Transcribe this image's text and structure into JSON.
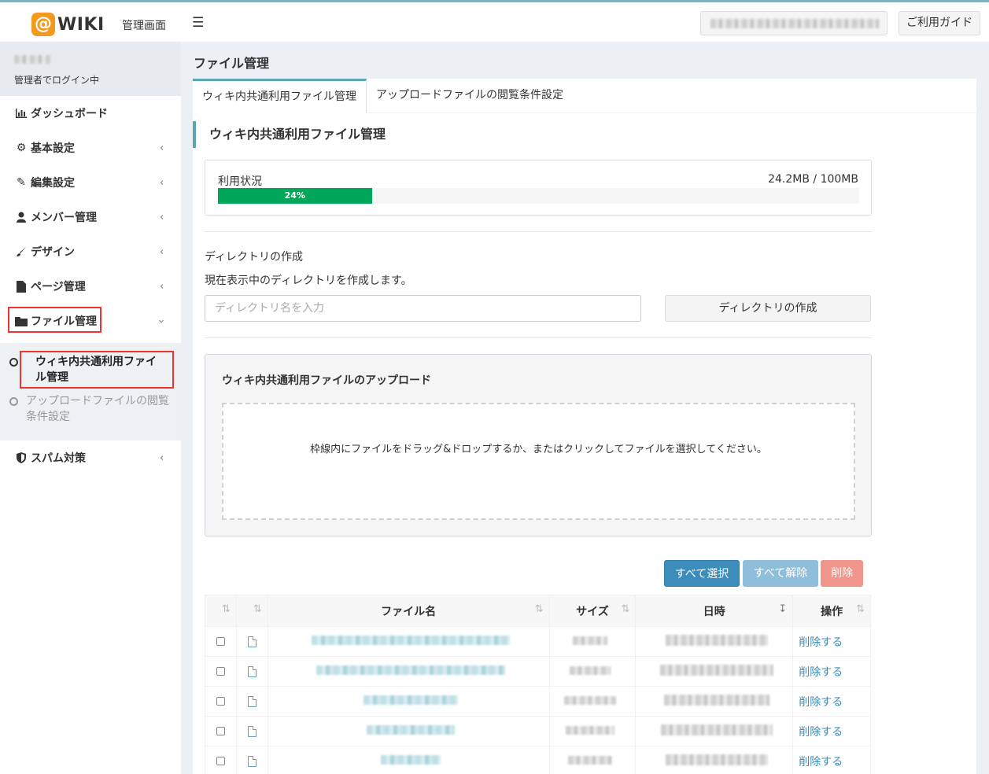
{
  "header": {
    "logo_mark": "@",
    "logo_text": "WIKI",
    "admin_label": "管理画面",
    "menu_icon": "hamburger-icon",
    "guide_label": "ご利用ガイド"
  },
  "sidebar": {
    "user_status": "管理者でログイン中",
    "items": [
      {
        "label": "ダッシュボード",
        "icon": "bar-chart-icon",
        "glyph": "📊"
      },
      {
        "label": "基本設定",
        "icon": "gear-icon",
        "glyph": "⚙"
      },
      {
        "label": "編集設定",
        "icon": "pencil-icon",
        "glyph": "✎"
      },
      {
        "label": "メンバー管理",
        "icon": "user-icon",
        "glyph": "👤"
      },
      {
        "label": "デザイン",
        "icon": "brush-icon",
        "glyph": "🖌"
      },
      {
        "label": "ページ管理",
        "icon": "file-icon",
        "glyph": "📄"
      },
      {
        "label": "ファイル管理",
        "icon": "folder-icon",
        "glyph": "📁"
      },
      {
        "label": "スパム対策",
        "icon": "shield-icon",
        "glyph": "🛡"
      }
    ],
    "sub_items": [
      {
        "label": "ウィキ内共通利用ファイル管理"
      },
      {
        "label": "アップロードファイルの閲覧条件設定"
      }
    ]
  },
  "main": {
    "page_title": "ファイル管理",
    "tabs": [
      {
        "label": "ウィキ内共通利用ファイル管理"
      },
      {
        "label": "アップロードファイルの閲覧条件設定"
      }
    ],
    "section_title": "ウィキ内共通利用ファイル管理",
    "usage": {
      "label": "利用状況",
      "amount": "24.2MB / 100MB",
      "percent_label": "24%",
      "percent": 24
    },
    "directory": {
      "title": "ディレクトリの作成",
      "description": "現在表示中のディレクトリを作成します。",
      "placeholder": "ディレクトリ名を入力",
      "button": "ディレクトリの作成"
    },
    "upload": {
      "title": "ウィキ内共通利用ファイルのアップロード",
      "dropzone_text": "枠線内にファイルをドラッグ&ドロップするか、またはクリックしてファイルを選択してください。"
    },
    "actions": {
      "select_all": "すべて選択",
      "unselect_all": "すべて解除",
      "delete": "削除"
    },
    "table": {
      "headers": [
        "",
        "",
        "ファイル名",
        "サイズ",
        "日時",
        "操作"
      ],
      "delete_link": "削除する",
      "row_count": 5
    }
  }
}
